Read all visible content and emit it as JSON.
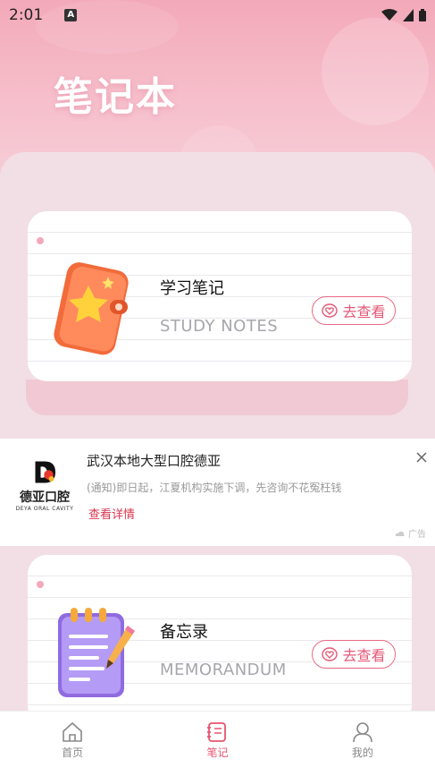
{
  "status_bar": {
    "time": "2:01",
    "notification_icon": "a-icon"
  },
  "header": {
    "title": "笔记本"
  },
  "cards": [
    {
      "title": "学习笔记",
      "subtitle": "STUDY NOTES",
      "button_label": "去查看",
      "icon": "notebook-star-icon"
    },
    {
      "title": "备忘录",
      "subtitle": "MEMORANDUM",
      "button_label": "去查看",
      "icon": "memo-pencil-icon"
    }
  ],
  "ad": {
    "brand_cn": "德亚口腔",
    "brand_en": "DEYA ORAL CAVITY",
    "title": "武汉本地大型口腔德亚",
    "description": "(通知)即日起，江夏机构实施下调，先咨询不花冤枉钱",
    "link": "查看详情",
    "label": "广告"
  },
  "tabs": [
    {
      "label": "首页",
      "icon": "home-icon",
      "active": false
    },
    {
      "label": "笔记",
      "icon": "notes-icon",
      "active": true
    },
    {
      "label": "我的",
      "icon": "user-icon",
      "active": false
    }
  ],
  "colors": {
    "accent": "#e7536f",
    "hero_pink": "#f3a9b9",
    "panel": "#f2dfe5"
  }
}
